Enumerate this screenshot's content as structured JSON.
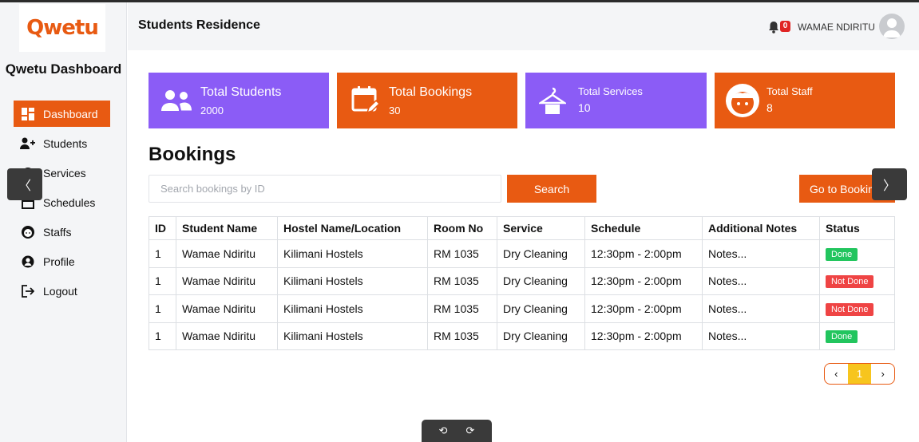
{
  "brand": {
    "logo_text": "Qwetu",
    "dashboard_title": "Qwetu Dashboard",
    "accent": "#e85a12"
  },
  "sidebar": {
    "items": [
      {
        "label": "Dashboard",
        "icon": "dashboard-icon",
        "active": true
      },
      {
        "label": "Students",
        "icon": "add-user-icon"
      },
      {
        "label": "Services",
        "icon": "services-icon"
      },
      {
        "label": "Schedules",
        "icon": "calendar-icon"
      },
      {
        "label": "Staffs",
        "icon": "staff-icon"
      },
      {
        "label": "Profile",
        "icon": "profile-icon"
      },
      {
        "label": "Logout",
        "icon": "logout-icon"
      }
    ]
  },
  "header": {
    "title": "Students Residence",
    "notification_count": "0",
    "user_name": "WAMAE NDIRITU"
  },
  "cards": [
    {
      "label": "Total Students",
      "value": "2000",
      "color": "#8b5cf6",
      "icon": "students-icon"
    },
    {
      "label": "Total Bookings",
      "value": "30",
      "color": "#e85a12",
      "icon": "calendar-edit-icon"
    },
    {
      "label": "Total Services",
      "value": "10",
      "color": "#8b5cf6",
      "icon": "hanger-icon"
    },
    {
      "label": "Total Staff",
      "value": "8",
      "color": "#e85a12",
      "icon": "face-icon"
    }
  ],
  "bookings": {
    "title": "Bookings",
    "search_placeholder": "Search bookings by ID",
    "search_label": "Search",
    "goto_label": "Go to Bookings",
    "columns": [
      "ID",
      "Student Name",
      "Hostel Name/Location",
      "Room No",
      "Service",
      "Schedule",
      "Additional Notes",
      "Status"
    ],
    "rows": [
      [
        "1",
        "Wamae Ndiritu",
        "Kilimani Hostels",
        "RM 1035",
        "Dry Cleaning",
        "12:30pm - 2:00pm",
        "Notes...",
        "Done"
      ],
      [
        "1",
        "Wamae Ndiritu",
        "Kilimani Hostels",
        "RM 1035",
        "Dry Cleaning",
        "12:30pm - 2:00pm",
        "Notes...",
        "Not Done"
      ],
      [
        "1",
        "Wamae Ndiritu",
        "Kilimani Hostels",
        "RM 1035",
        "Dry Cleaning",
        "12:30pm - 2:00pm",
        "Notes...",
        "Not Done"
      ],
      [
        "1",
        "Wamae Ndiritu",
        "Kilimani Hostels",
        "RM 1035",
        "Dry Cleaning",
        "12:30pm - 2:00pm",
        "Notes...",
        "Done"
      ]
    ],
    "status_colors": {
      "Done": "#22c55e",
      "Not Done": "#ef4444"
    }
  },
  "pagination": {
    "prev": "‹",
    "current": "1",
    "next": "›"
  },
  "carousel": {
    "prev": "〈",
    "next": "〉"
  },
  "toolbar": {
    "rotate_left": "⟲",
    "rotate_right": "⟳"
  }
}
